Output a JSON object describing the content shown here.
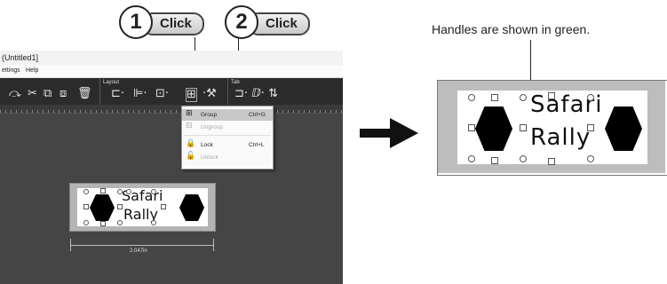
{
  "callouts": [
    {
      "num": "1",
      "label": "Click"
    },
    {
      "num": "2",
      "label": "Click"
    }
  ],
  "app": {
    "title": "(Untitled1]",
    "menu": [
      "ettings",
      "Help"
    ],
    "ribbon": {
      "groups": [
        "Layout",
        "Tab"
      ],
      "icons": [
        "rotate-icon",
        "cut-icon",
        "copy-icon",
        "paste-icon",
        "delete-icon",
        "align-icon",
        "distribute-icon",
        "order-icon",
        "group-icon",
        "tools-icon",
        "tab-order-icon"
      ]
    },
    "dropdown": {
      "items": [
        {
          "label": "Group",
          "shortcut": "Ctrl+G",
          "icon": "group-icon",
          "highlighted": true,
          "enabled": true
        },
        {
          "label": "Ungroup",
          "shortcut": "",
          "icon": "ungroup-icon",
          "highlighted": false,
          "enabled": false
        },
        {
          "label": "Lock",
          "shortcut": "Ctrl+L",
          "icon": "lock-icon",
          "highlighted": false,
          "enabled": true
        },
        {
          "label": "Unlock",
          "shortcut": "",
          "icon": "unlock-icon",
          "highlighted": false,
          "enabled": false
        }
      ]
    },
    "label_preview": {
      "line1": "Safari",
      "line2": "Rally",
      "width": "2.047in"
    }
  },
  "note": "Handles are shown in green.",
  "zoom_label": {
    "line1": "Safari",
    "line2": "Rally"
  },
  "colors": {
    "handle_note": "green",
    "selection_handle": "#555555",
    "dropdown_highlight": "#c8c8c8"
  }
}
